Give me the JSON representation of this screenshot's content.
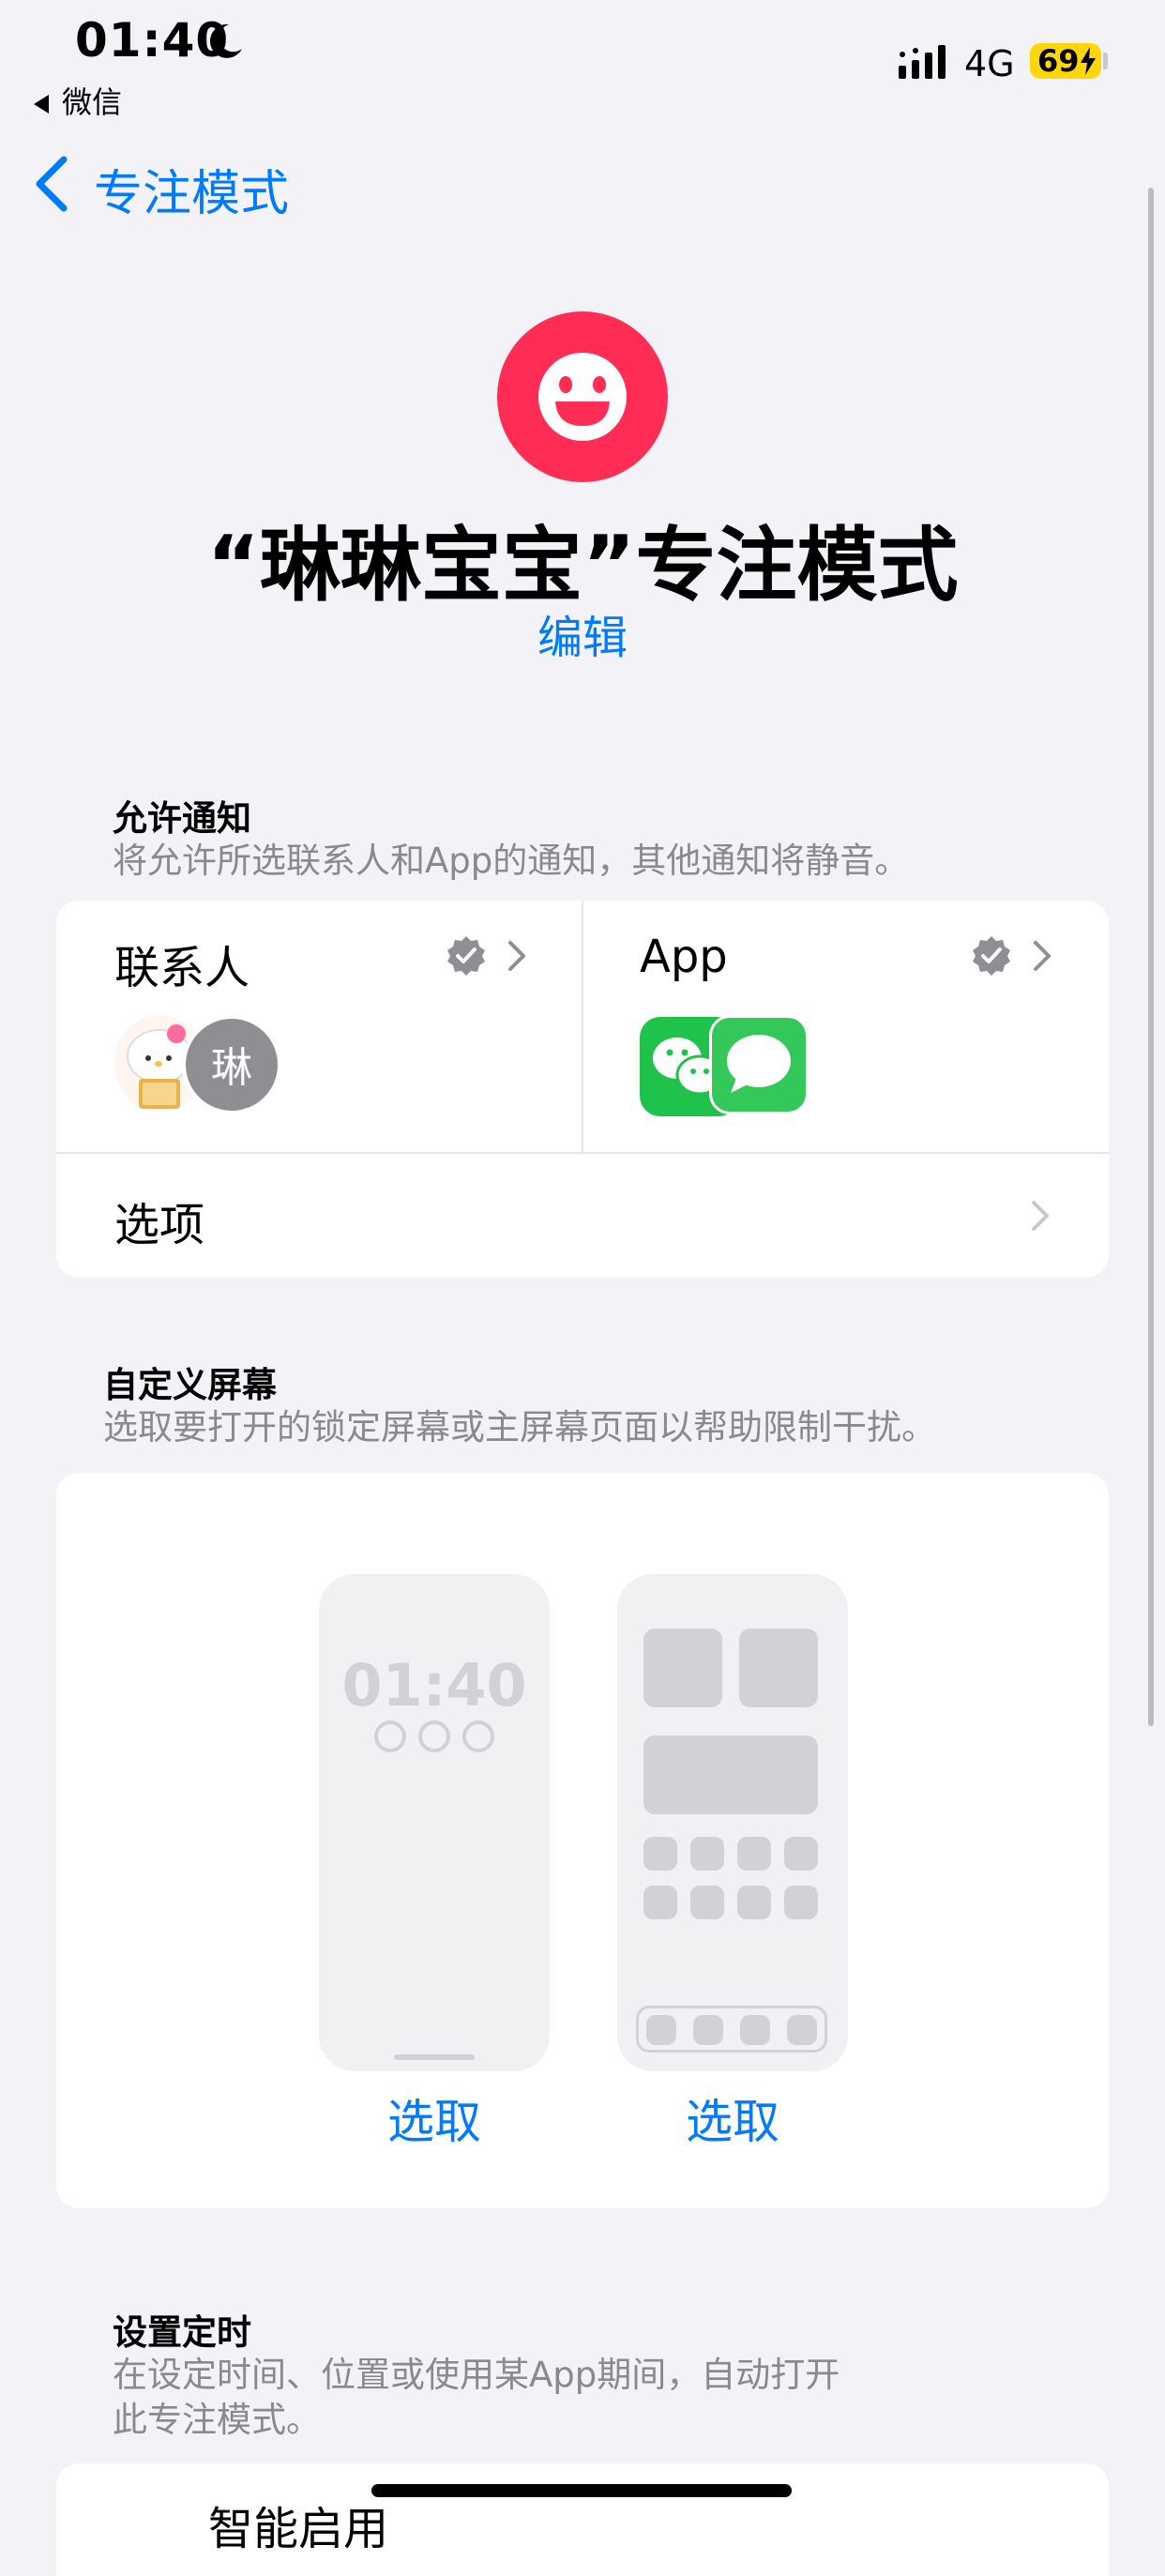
{
  "status_bar": {
    "time": "01:40",
    "back_app": "微信",
    "network": "4G",
    "battery": "69"
  },
  "nav": {
    "back_label": "专注模式"
  },
  "header": {
    "title": "“琳琳宝宝”专注模式",
    "edit_label": "编辑",
    "icon": "smiley-face-icon",
    "icon_color": "#ff2d55"
  },
  "allow_notifications": {
    "title": "允许通知",
    "description": "将允许所选联系人和App的通知，其他通知将静音。",
    "contacts_label": "联系人",
    "contact_avatar_initial": "琳",
    "apps_label": "App",
    "options_label": "选项"
  },
  "custom_screen": {
    "title": "自定义屏幕",
    "description": "选取要打开的锁定屏幕或主屏幕页面以帮助限制干扰。",
    "lock_preview_time": "01:40",
    "lock_select_label": "选取",
    "home_select_label": "选取"
  },
  "schedule": {
    "title": "设置定时",
    "description_line1": "在设定时间、位置或使用某App期间，自动打开",
    "description_line2": "此专注模式。",
    "row_label": "智能启用"
  },
  "colors": {
    "accent": "#007aff",
    "background": "#f2f2f7",
    "battery": "#ffd60a"
  }
}
